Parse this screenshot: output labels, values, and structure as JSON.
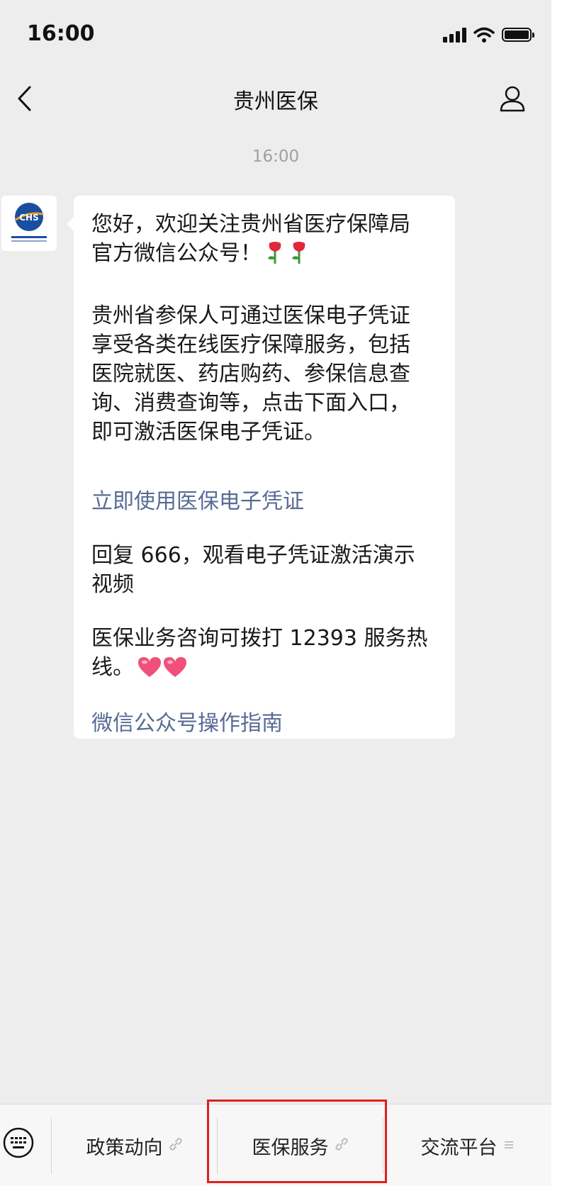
{
  "status_bar": {
    "time": "16:00"
  },
  "nav": {
    "title": "贵州医保"
  },
  "chat": {
    "timestamp": "16:00",
    "avatar_label": "CHS",
    "message": {
      "p1_line1": "您好，欢迎关注贵州省医疗保障局",
      "p1_line2": "官方微信公众号！",
      "p2_line1": "贵州省参保人可通过医保电子凭证",
      "p2_line2": "享受各类在线医疗保障服务，包括",
      "p2_line3": "医院就医、药店购药、参保信息查",
      "p2_line4": "询、消费查询等，点击下面入口，",
      "p2_line5": "即可激活医保电子凭证。",
      "link1": "立即使用医保电子凭证",
      "p3_line1": "回复 666，观看电子凭证激活演示",
      "p3_line2": "视频",
      "p4_line1": "医保业务咨询可拨打 12393 服务热",
      "p4_line2": "线。",
      "link2": "微信公众号操作指南"
    }
  },
  "menu": {
    "items": [
      {
        "label": "政策动向",
        "icon": "link-icon"
      },
      {
        "label": "医保服务",
        "icon": "link-icon"
      },
      {
        "label": "交流平台",
        "icon": "menu-lines-icon"
      }
    ]
  },
  "colors": {
    "link": "#576b95",
    "highlight": "#e02020",
    "background": "#ededed"
  }
}
